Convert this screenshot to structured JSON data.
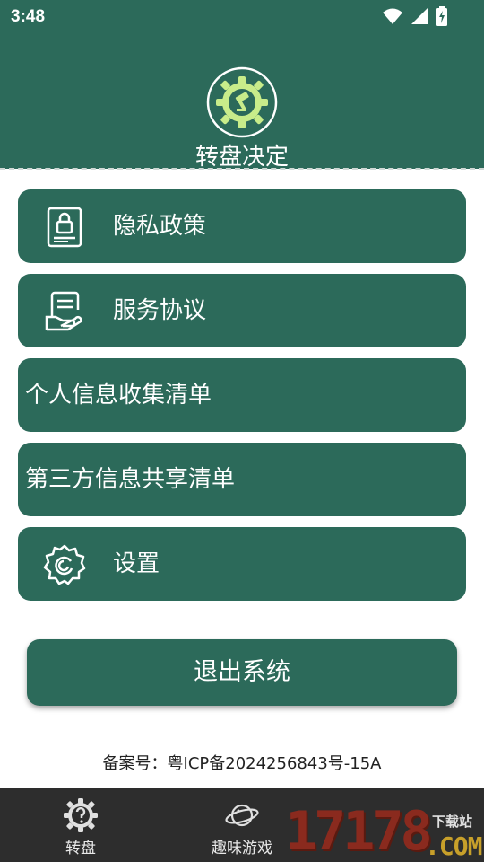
{
  "status_bar": {
    "time": "3:48"
  },
  "header": {
    "title": "转盘决定"
  },
  "menu": [
    {
      "label": "隐私政策",
      "icon": "lock-document-icon"
    },
    {
      "label": "服务协议",
      "icon": "agreement-hand-icon"
    },
    {
      "label": "个人信息收集清单",
      "icon": ""
    },
    {
      "label": "第三方信息共享清单",
      "icon": ""
    },
    {
      "label": "设置",
      "icon": "gear-icon"
    }
  ],
  "exit_label": "退出系统",
  "icp": "备案号：粤ICP备2024256843号-15A",
  "bottom_nav": [
    {
      "label": "转盘",
      "icon": "wheel-question-icon"
    },
    {
      "label": "趣味游戏",
      "icon": "planet-icon"
    }
  ],
  "watermark": {
    "number": "17178",
    "download": "下载站",
    "com": ".COM"
  },
  "colors": {
    "primary": "#2c6a5a",
    "nav_bg": "#2d2d2d",
    "logo_accent": "#c8ec8a"
  }
}
